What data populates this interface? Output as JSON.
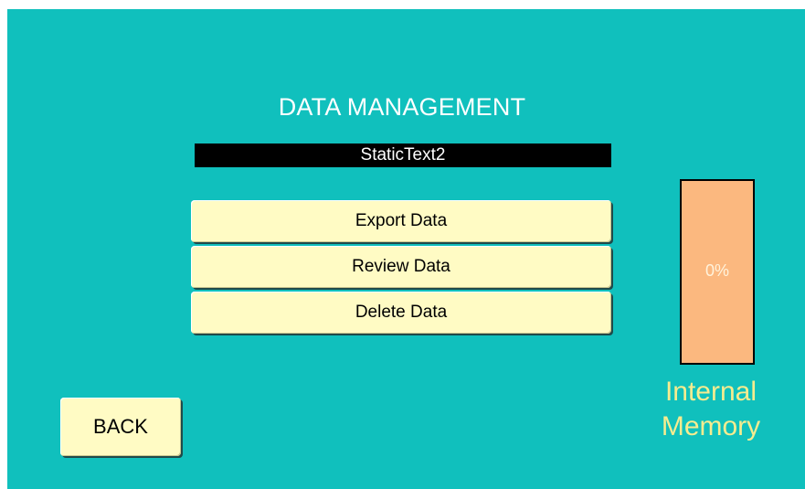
{
  "screen": {
    "title": "DATA MANAGEMENT",
    "status_text": "StaticText2",
    "background_color": "#10c0bd"
  },
  "menu": {
    "export_label": "Export Data",
    "review_label": "Review Data",
    "delete_label": "Delete Data"
  },
  "navigation": {
    "back_label": "BACK"
  },
  "memory": {
    "percent_text": "0%",
    "usage_fraction": 0.0,
    "label_line1": "Internal",
    "label_line2": "Memory",
    "gauge_color": "#fbb87f",
    "label_color": "#f6ec8f"
  }
}
